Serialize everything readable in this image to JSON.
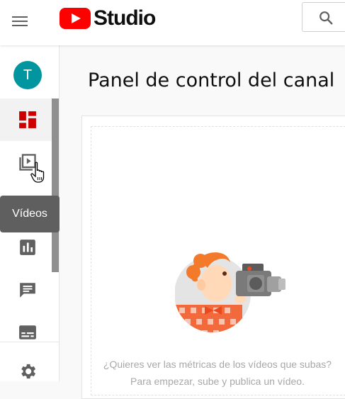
{
  "header": {
    "logo_text": "Studio"
  },
  "sidebar": {
    "avatar_initial": "T",
    "tooltip": "Vídeos",
    "items": [
      {
        "icon": "dashboard-icon",
        "label": "Panel de control"
      },
      {
        "icon": "videos-icon",
        "label": "Vídeos"
      },
      {
        "icon": "analytics-icon",
        "label": "Estadísticas"
      },
      {
        "icon": "comments-icon",
        "label": "Comentarios"
      },
      {
        "icon": "subtitles-icon",
        "label": "Subtítulos"
      },
      {
        "icon": "settings-icon",
        "label": "Configuración"
      }
    ]
  },
  "main": {
    "title": "Panel de control del canal",
    "empty_line1": "¿Quieres ver las métricas de los vídeos que subas?",
    "empty_line2": "Para empezar, sube y publica un vídeo."
  },
  "colors": {
    "brand_red": "#ff0000",
    "avatar": "#00959f",
    "dashboard_active": "#cc0000"
  }
}
